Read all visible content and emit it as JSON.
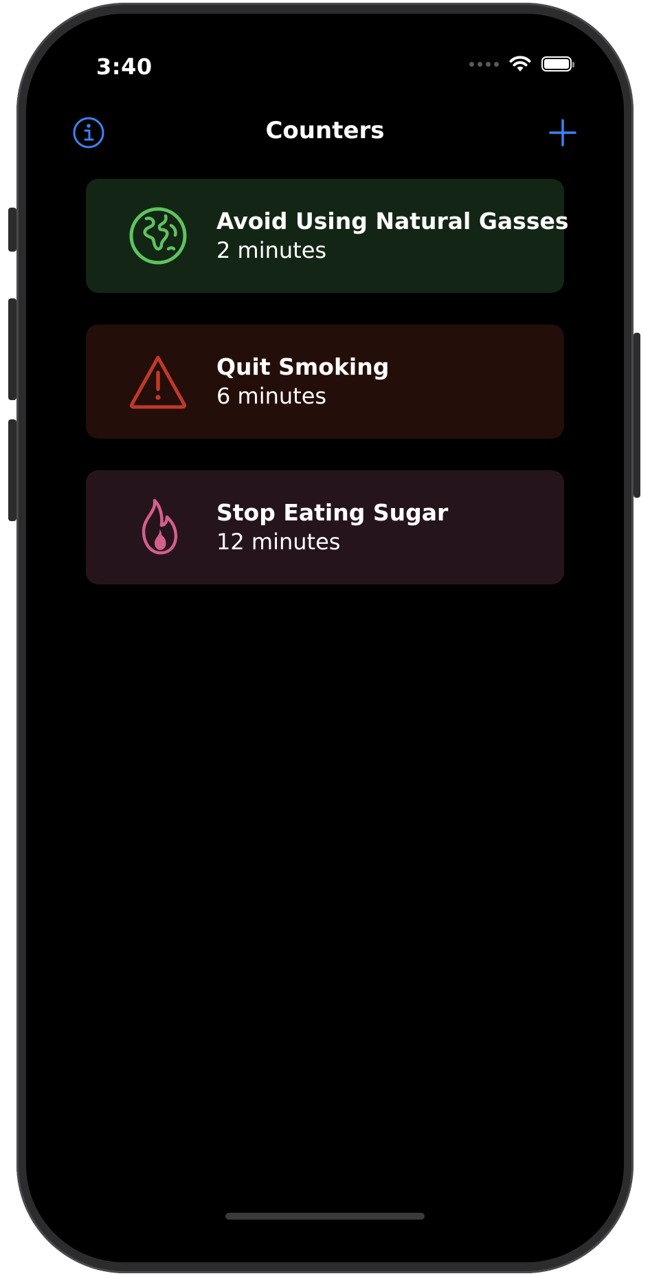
{
  "status_bar": {
    "time": "3:40"
  },
  "nav": {
    "title": "Counters",
    "info_icon": "info-circle-icon",
    "add_icon": "plus-icon"
  },
  "colors": {
    "accent": "#3b82f6",
    "background": "#000000"
  },
  "counters": [
    {
      "title": "Avoid Using Natural Gasses",
      "elapsed": "2 minutes",
      "icon": "globe-icon",
      "icon_color": "#5fc35f",
      "card_color": "#132616"
    },
    {
      "title": "Quit Smoking",
      "elapsed": "6 minutes",
      "icon": "warning-triangle-icon",
      "icon_color": "#c0392b",
      "card_color": "#240e0a"
    },
    {
      "title": "Stop Eating Sugar",
      "elapsed": "12 minutes",
      "icon": "flame-icon",
      "icon_color": "#d35f8d",
      "card_color": "#26141c"
    }
  ]
}
